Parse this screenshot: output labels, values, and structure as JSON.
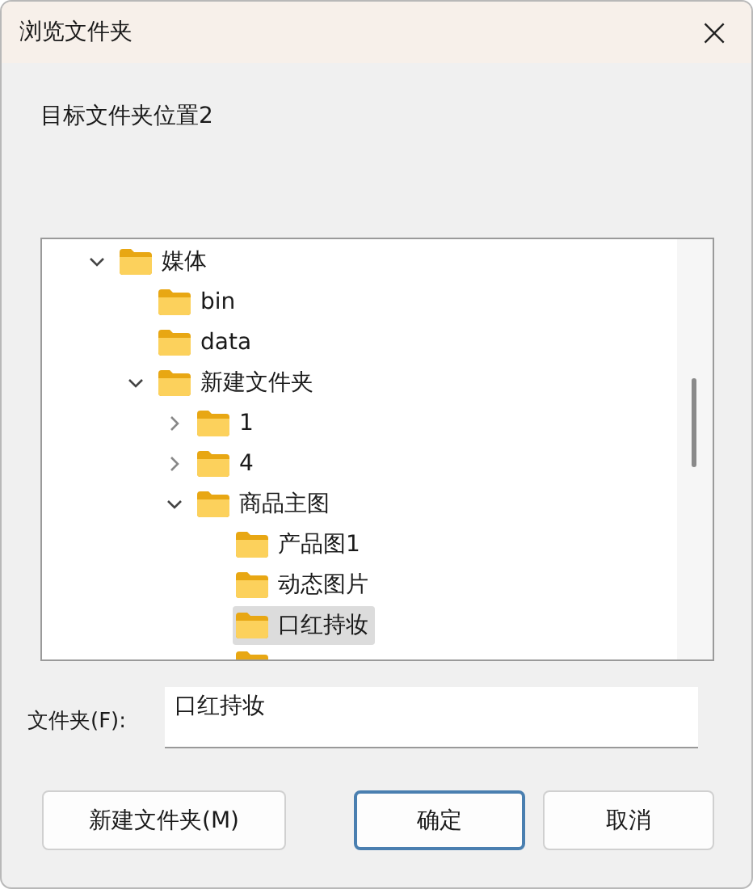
{
  "window": {
    "title": "浏览文件夹",
    "close": "×"
  },
  "description": "目标文件夹位置2",
  "tree": [
    {
      "label": "媒体",
      "expanded": true,
      "selected": false,
      "children": [
        {
          "label": "bin",
          "selected": false
        },
        {
          "label": "data",
          "selected": false
        },
        {
          "label": "新建文件夹",
          "expanded": true,
          "selected": false,
          "children": [
            {
              "label": "1",
              "expanded": false,
              "selected": false
            },
            {
              "label": "4",
              "expanded": false,
              "selected": false
            },
            {
              "label": "商品主图",
              "expanded": true,
              "selected": false,
              "children": [
                {
                  "label": "产品图1",
                  "selected": false
                },
                {
                  "label": "动态图片",
                  "selected": false
                },
                {
                  "label": "口红持妆",
                  "selected": true
                },
                {
                  "kind": "cut"
                }
              ]
            }
          ]
        }
      ]
    }
  ],
  "folder_field": {
    "label": "文件夹(F):",
    "value": "口红持妆"
  },
  "buttons": [
    {
      "label": "新建文件夹(M)",
      "default": false
    },
    {
      "label": "确定",
      "default": true
    },
    {
      "label": "取消",
      "default": false
    }
  ]
}
